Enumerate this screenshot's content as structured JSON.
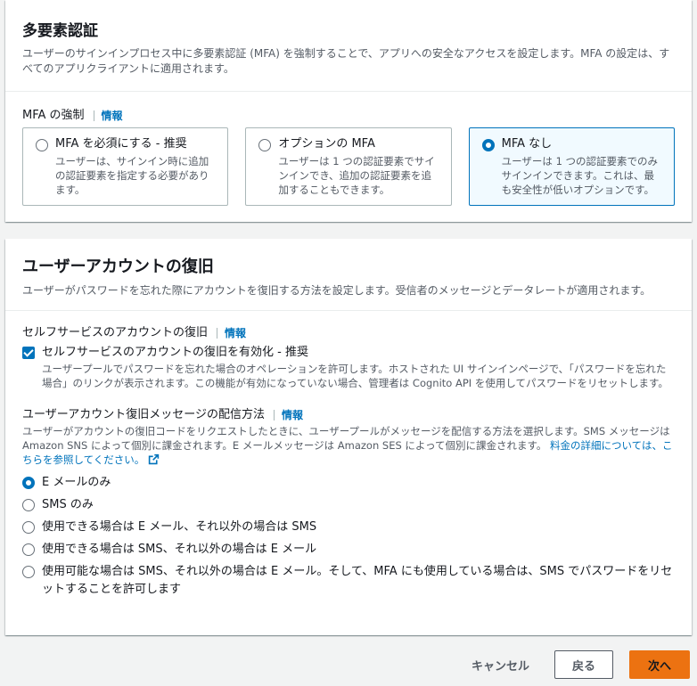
{
  "mfa": {
    "title": "多要素認証",
    "description": "ユーザーのサインインプロセス中に多要素認証 (MFA) を強制することで、アプリへの安全なアクセスを設定します。MFA の設定は、すべてのアプリクライアントに適用されます。",
    "enforcement_label": "MFA の強制",
    "info": "情報",
    "options": [
      {
        "title": "MFA を必須にする - 推奨",
        "desc": "ユーザーは、サインイン時に追加の認証要素を指定する必要があります。",
        "selected": false
      },
      {
        "title": "オプションの MFA",
        "desc": "ユーザーは 1 つの認証要素でサインインでき、追加の認証要素を追加することもできます。",
        "selected": false
      },
      {
        "title": "MFA なし",
        "desc": "ユーザーは 1 つの認証要素でのみサインインできます。これは、最も安全性が低いオプションです。",
        "selected": true
      }
    ]
  },
  "recovery": {
    "title": "ユーザーアカウントの復旧",
    "description": "ユーザーがパスワードを忘れた際にアカウントを復旧する方法を設定します。受信者のメッセージとデータレートが適用されます。",
    "self_service_label": "セルフサービスのアカウントの復旧",
    "info": "情報",
    "enable_label": "セルフサービスのアカウントの復旧を有効化 - 推奨",
    "enable_desc": "ユーザープールでパスワードを忘れた場合のオペレーションを許可します。ホストされた UI サインインページで、「パスワードを忘れた場合」のリンクが表示されます。この機能が有効になっていない場合、管理者は Cognito API を使用してパスワードをリセットします。",
    "delivery_label": "ユーザーアカウント復旧メッセージの配信方法",
    "delivery_desc": "ユーザーがアカウントの復旧コードをリクエストしたときに、ユーザープールがメッセージを配信する方法を選択します。SMS メッセージは Amazon SNS によって個別に課金されます。E メールメッセージは Amazon SES によって個別に課金されます。",
    "pricing_link": "料金の詳細については、こちらを参照してください。",
    "delivery_options": [
      {
        "label": "E メールのみ",
        "selected": true
      },
      {
        "label": "SMS のみ",
        "selected": false
      },
      {
        "label": "使用できる場合は E メール、それ以外の場合は SMS",
        "selected": false
      },
      {
        "label": "使用できる場合は SMS、それ以外の場合は E メール",
        "selected": false
      },
      {
        "label": "使用可能な場合は SMS、それ以外の場合は E メール。そして、MFA にも使用している場合は、SMS でパスワードをリセットすることを許可します",
        "selected": false
      }
    ]
  },
  "footer": {
    "cancel": "キャンセル",
    "back": "戻る",
    "next": "次へ"
  }
}
